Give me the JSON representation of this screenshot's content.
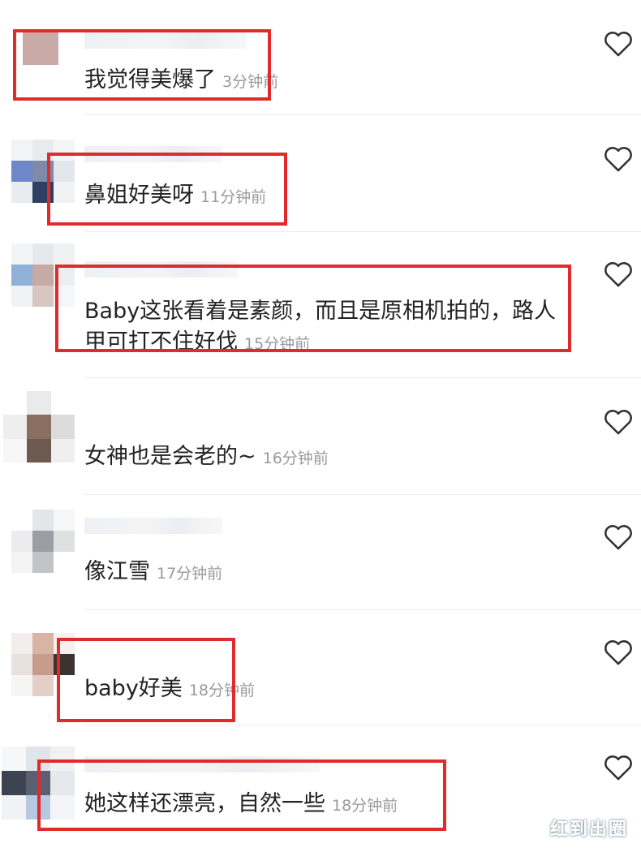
{
  "comments": [
    {
      "text": "我觉得美爆了",
      "time": "3分钟前",
      "highlighted": true
    },
    {
      "text": "鼻姐好美呀",
      "time": "11分钟前",
      "highlighted": true
    },
    {
      "text": "Baby这张看着是素颜，而且是原相机拍的，路人甲可打不住好伐",
      "time": "15分钟前",
      "highlighted": true
    },
    {
      "text": "女神也是会老的~",
      "time": "16分钟前",
      "highlighted": false
    },
    {
      "text": "像江雪",
      "time": "17分钟前",
      "highlighted": false
    },
    {
      "text": "baby好美",
      "time": "18分钟前",
      "highlighted": true
    },
    {
      "text": "她这样还漂亮，自然一些",
      "time": "18分钟前",
      "highlighted": true
    }
  ],
  "icons": {
    "like": "heart-outline-icon"
  },
  "colors": {
    "highlight": "#e12a2a",
    "time": "#9a9a9a",
    "text": "#222222"
  },
  "watermark": "红到出圈"
}
